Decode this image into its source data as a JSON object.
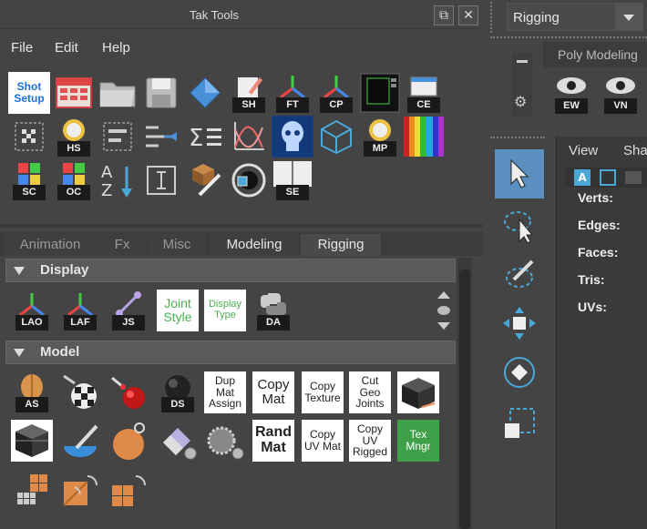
{
  "window": {
    "title": "Tak Tools",
    "restore_glyph": "⧉",
    "close_glyph": "✕"
  },
  "menu": [
    "File",
    "Edit",
    "Help"
  ],
  "toolbar": {
    "shot_setup": "Shot Setup",
    "tags": {
      "sh": "SH",
      "ft": "FT",
      "cp": "CP",
      "ce": "CE",
      "hs": "HS",
      "mp": "MP",
      "sc": "SC",
      "oc": "OC",
      "se": "SE"
    }
  },
  "tabs": [
    "Animation",
    "Fx",
    "Misc",
    "Modeling",
    "Rigging"
  ],
  "active_tab": "Rigging",
  "sections": {
    "display": "Display",
    "model": "Model"
  },
  "display_tools": {
    "lao": "LAO",
    "laf": "LAF",
    "js": "JS",
    "joint_style": "Joint Style",
    "display_type": "Display Type",
    "da": "DA"
  },
  "model_tools": {
    "as": "AS",
    "ds": "DS",
    "dup_mat_assign": "Dup Mat Assign",
    "copy_mat": "Copy Mat",
    "copy_texture": "Copy Texture",
    "cut_geo_joints": "Cut Geo Joints",
    "rand_mat": "Rand Mat",
    "copy_uv_mat": "Copy UV Mat",
    "copy_uv_rigged": "Copy UV Rigged",
    "tex_mngr": "Tex Mngr"
  },
  "right": {
    "dropdown": "Rigging",
    "shelf_tab": "Poly Modeling",
    "ew": "EW",
    "vn": "VN",
    "view_menu": "View",
    "shading_menu": "Sha",
    "info": [
      "Verts:",
      "Edges:",
      "Faces:",
      "Tris:",
      "UVs:"
    ]
  },
  "colors": {
    "accent": "#5a8fbf",
    "tex_mngr": "#3fa04a",
    "joint_green": "#4caf50"
  }
}
